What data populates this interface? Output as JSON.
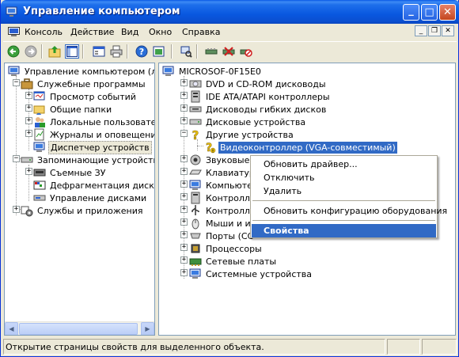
{
  "window": {
    "title": "Управление компьютером",
    "buttons": {
      "minimize": "_",
      "maximize": "□",
      "close": "✕"
    }
  },
  "menubar": {
    "items": [
      "Консоль",
      "Действие",
      "Вид",
      "Окно",
      "Справка"
    ],
    "mdi": {
      "minimize": "_",
      "restore": "❐",
      "close": "✕"
    }
  },
  "toolbar": {
    "buttons": [
      "back-icon",
      "forward-icon",
      "up-icon",
      "show-hide-tree-icon",
      "properties-icon",
      "print-icon",
      "help-icon",
      "export-icon",
      "scan-hardware-icon",
      "update-driver-icon",
      "uninstall-icon",
      "disable-icon"
    ]
  },
  "left_tree": {
    "items": [
      {
        "label": "Управление компьютером (лока",
        "icon": "computer-management-icon"
      },
      {
        "label": "Служебные программы",
        "icon": "tools-icon"
      },
      {
        "label": "Просмотр событий",
        "icon": "event-viewer-icon"
      },
      {
        "label": "Общие папки",
        "icon": "shared-folders-icon"
      },
      {
        "label": "Локальные пользовател",
        "icon": "users-icon"
      },
      {
        "label": "Журналы и оповещения",
        "icon": "logs-icon"
      },
      {
        "label": "Диспетчер устройств",
        "icon": "device-manager-icon"
      },
      {
        "label": "Запоминающие устройства",
        "icon": "storage-icon"
      },
      {
        "label": "Съемные ЗУ",
        "icon": "removable-storage-icon"
      },
      {
        "label": "Дефрагментация диска",
        "icon": "defrag-icon"
      },
      {
        "label": "Управление дисками",
        "icon": "disk-management-icon"
      },
      {
        "label": "Службы и приложения",
        "icon": "services-icon"
      }
    ]
  },
  "right_tree": {
    "root": "MICROSOF-0F15E0",
    "items": [
      {
        "label": "DVD и CD-ROM дисководы",
        "icon": "cdrom-icon"
      },
      {
        "label": "IDE ATA/ATAPI контроллеры",
        "icon": "ide-icon"
      },
      {
        "label": "Дисководы гибких дисков",
        "icon": "floppy-icon"
      },
      {
        "label": "Дисковые устройства",
        "icon": "disk-drive-icon"
      },
      {
        "label": "Другие устройства",
        "icon": "question-icon"
      },
      {
        "label": "Видеоконтроллер (VGA-совместимый)",
        "icon": "unknown-device-icon"
      },
      {
        "label": "Звуковые,",
        "icon": "sound-icon"
      },
      {
        "label": "Клавиатур",
        "icon": "keyboard-icon"
      },
      {
        "label": "Компьютер",
        "icon": "computer-icon"
      },
      {
        "label": "Контролле",
        "icon": "controller-icon"
      },
      {
        "label": "Контролле",
        "icon": "usb-icon"
      },
      {
        "label": "Мыши и ин",
        "icon": "mouse-icon"
      },
      {
        "label": "Порты (CC",
        "icon": "port-icon"
      },
      {
        "label": "Процессоры",
        "icon": "cpu-icon"
      },
      {
        "label": "Сетевые платы",
        "icon": "network-icon"
      },
      {
        "label": "Системные устройства",
        "icon": "system-icon"
      }
    ]
  },
  "context_menu": {
    "items": [
      "Обновить драйвер...",
      "Отключить",
      "Удалить",
      "Обновить конфигурацию оборудования",
      "Свойства"
    ],
    "active": "Свойства"
  },
  "statusbar": {
    "text": "Открытие страницы свойств для выделенного объекта."
  },
  "colors": {
    "titlebar": "#0958E0",
    "selection": "#316AC5",
    "face": "#ECE9D8"
  }
}
